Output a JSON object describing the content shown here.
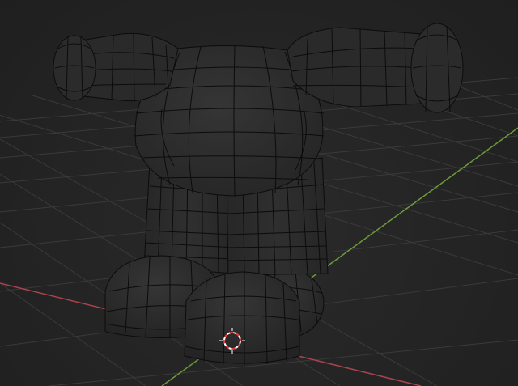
{
  "viewport": {
    "mode": "edit-mode-wireframe",
    "background_color": "#232323",
    "grid_color": "#3a3a3a",
    "axis_x_color": "#a8434c",
    "axis_y_color": "#6b9a3a",
    "wire_color": "#0c0c0c",
    "mesh_fill": "#2c2c2c",
    "cursor_color_a": "#e04040",
    "cursor_color_b": "#ffffff"
  },
  "icons": {
    "cursor": "3d-cursor-icon"
  }
}
